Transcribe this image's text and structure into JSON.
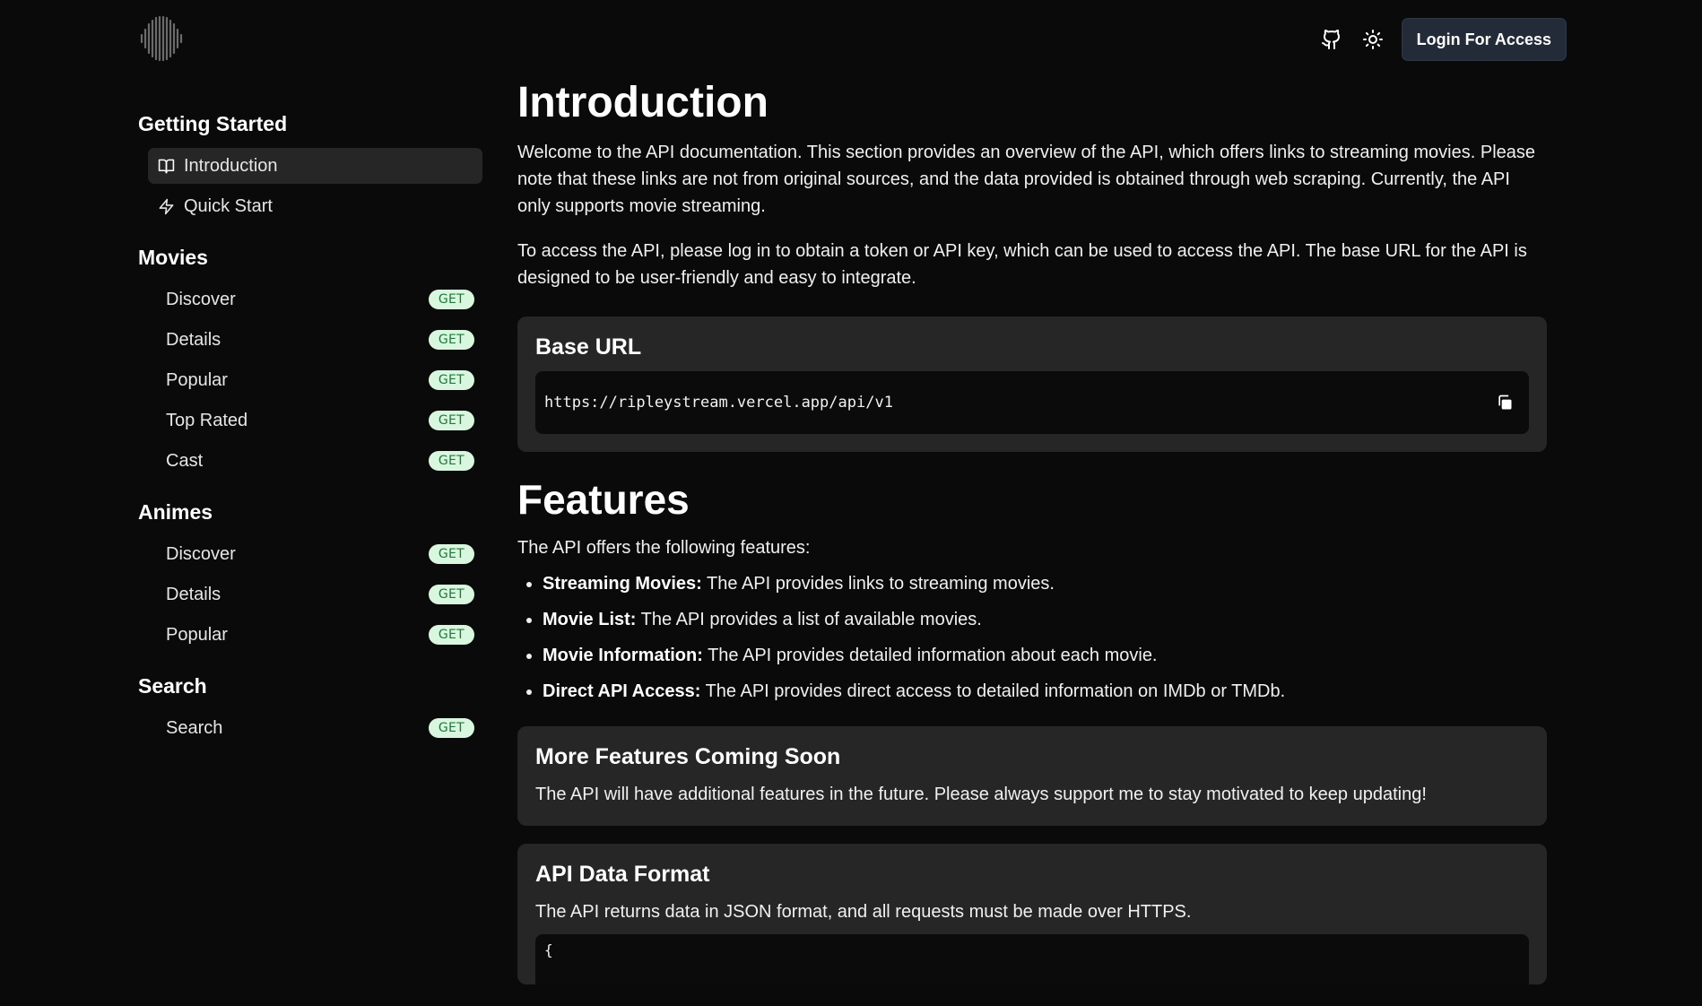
{
  "header": {
    "logo_icon": "waveform-logo-icon",
    "github_icon": "github-icon",
    "theme_icon": "sun-icon",
    "login_label": "Login For Access"
  },
  "sidebar": {
    "sections": [
      {
        "title": "Getting Started",
        "items": [
          {
            "label": "Introduction",
            "icon": "book-icon",
            "active": true
          },
          {
            "label": "Quick Start",
            "icon": "zap-icon"
          }
        ]
      },
      {
        "title": "Movies",
        "items": [
          {
            "label": "Discover",
            "badge": "GET"
          },
          {
            "label": "Details",
            "badge": "GET"
          },
          {
            "label": "Popular",
            "badge": "GET"
          },
          {
            "label": "Top Rated",
            "badge": "GET"
          },
          {
            "label": "Cast",
            "badge": "GET"
          }
        ]
      },
      {
        "title": "Animes",
        "items": [
          {
            "label": "Discover",
            "badge": "GET"
          },
          {
            "label": "Details",
            "badge": "GET"
          },
          {
            "label": "Popular",
            "badge": "GET"
          }
        ]
      },
      {
        "title": "Search",
        "items": [
          {
            "label": "Search",
            "badge": "GET"
          }
        ]
      }
    ]
  },
  "main": {
    "title": "Introduction",
    "intro_p1": "Welcome to the API documentation. This section provides an overview of the API, which offers links to streaming movies. Please note that these links are not from original sources, and the data provided is obtained through web scraping. Currently, the API only supports movie streaming.",
    "intro_p2": "To access the API, please log in to obtain a token or API key, which can be used to access the API. The base URL for the API is designed to be user-friendly and easy to integrate.",
    "base_url_card": {
      "title": "Base URL",
      "url": "https://ripleystream.vercel.app/api/v1",
      "copy_icon": "copy-icon"
    },
    "features": {
      "title": "Features",
      "intro": "The API offers the following features:",
      "items": [
        {
          "name": "Streaming Movies:",
          "desc": " The API provides links to streaming movies."
        },
        {
          "name": "Movie List:",
          "desc": " The API provides a list of available movies."
        },
        {
          "name": "Movie Information:",
          "desc": " The API provides detailed information about each movie."
        },
        {
          "name": "Direct API Access:",
          "desc": " The API provides direct access to detailed information on IMDb or TMDb."
        }
      ]
    },
    "coming_soon_card": {
      "title": "More Features Coming Soon",
      "text": "The API will have additional features in the future. Please always support me to stay motivated to keep updating!"
    },
    "data_format_card": {
      "title": "API Data Format",
      "text": "The API returns data in JSON format, and all requests must be made over HTTPS.",
      "code_start": "{"
    }
  },
  "colors": {
    "background": "#0a0a0a",
    "card": "#262626",
    "badge_bg": "#d8f7de",
    "badge_text": "#1c7a3a"
  }
}
